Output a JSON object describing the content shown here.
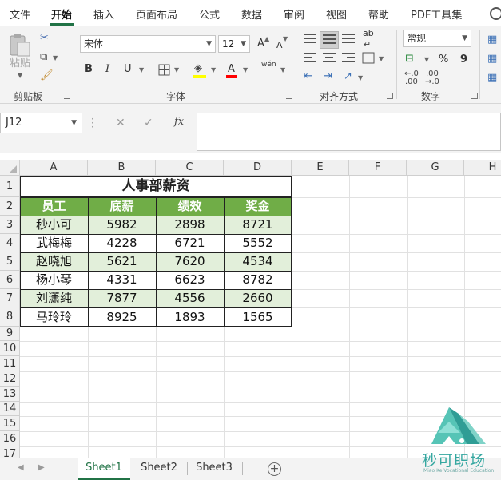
{
  "ribbon_tabs": [
    "文件",
    "开始",
    "插入",
    "页面布局",
    "公式",
    "数据",
    "审阅",
    "视图",
    "帮助",
    "PDF工具集"
  ],
  "active_tab": "开始",
  "ribbon": {
    "clipboard": {
      "paste_label": "粘贴",
      "group_label": "剪贴板"
    },
    "font": {
      "font_name": "宋体",
      "font_size": "12",
      "bold": "B",
      "italic": "I",
      "underline": "U",
      "grow": "A",
      "shrink": "A",
      "font_color": "A",
      "phonetic": "wén",
      "group_label": "字体"
    },
    "alignment": {
      "group_label": "对齐方式",
      "wrap": "ab"
    },
    "number": {
      "format": "常规",
      "percent": "%",
      "comma": "9",
      "group_label": "数字"
    }
  },
  "formula_bar": {
    "name_box": "J12",
    "fx": "fx",
    "formula": ""
  },
  "sheet": {
    "columns": [
      "A",
      "B",
      "C",
      "D",
      "E",
      "F",
      "G",
      "H"
    ],
    "rows": [
      "1",
      "2",
      "3",
      "4",
      "5",
      "6",
      "7",
      "8",
      "9",
      "10",
      "11",
      "12",
      "13",
      "14",
      "15",
      "16",
      "17"
    ],
    "title": "人事部薪资",
    "headers": [
      "员工",
      "底薪",
      "绩效",
      "奖金"
    ],
    "data": [
      [
        "秒小可",
        "5982",
        "2898",
        "8721"
      ],
      [
        "武梅梅",
        "4228",
        "6721",
        "5552"
      ],
      [
        "赵晓旭",
        "5621",
        "7620",
        "4534"
      ],
      [
        "杨小琴",
        "4331",
        "6623",
        "8782"
      ],
      [
        "刘潇纯",
        "7877",
        "4556",
        "2660"
      ],
      [
        "马玲玲",
        "8925",
        "1893",
        "1565"
      ]
    ]
  },
  "sheet_tabs": [
    "Sheet1",
    "Sheet2",
    "Sheet3"
  ],
  "active_sheet": "Sheet1",
  "watermark": {
    "name": "秒可职场",
    "sub": "Miao Ke Vocational Education"
  },
  "colors": {
    "accent": "#217346",
    "header_fill": "#70ad47",
    "band_fill": "#e2efda",
    "watermark": "#35a7a0"
  }
}
